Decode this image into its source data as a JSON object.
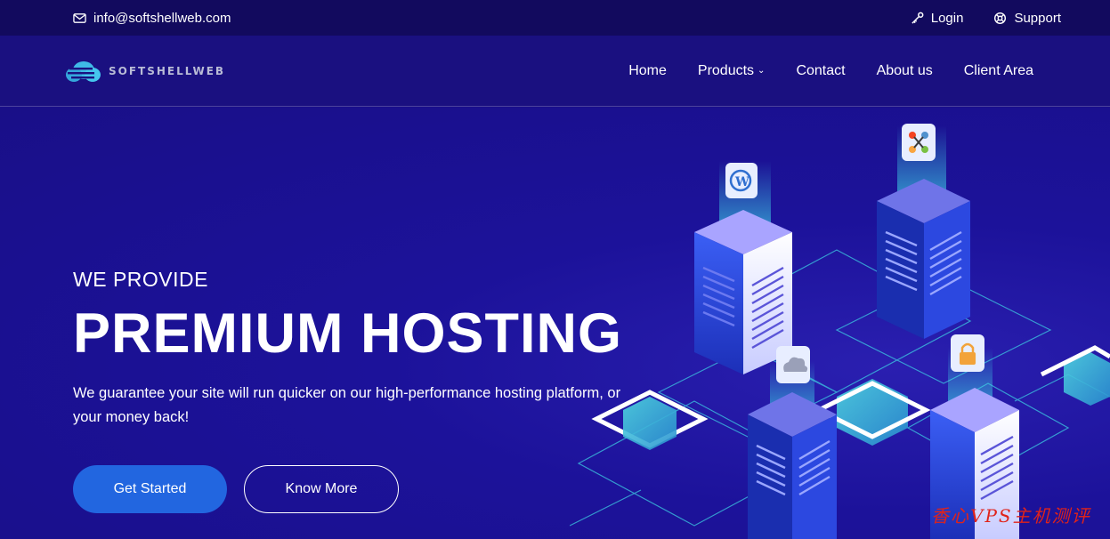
{
  "topbar": {
    "email": "info@softshellweb.com",
    "login_label": "Login",
    "support_label": "Support"
  },
  "brand": {
    "name": "SoftShellWeb"
  },
  "nav": {
    "items": [
      {
        "label": "Home"
      },
      {
        "label": "Products"
      },
      {
        "label": "Contact"
      },
      {
        "label": "About us"
      },
      {
        "label": "Client Area"
      }
    ]
  },
  "hero": {
    "pretitle": "WE PROVIDE",
    "title": "PREMIUM HOSTING",
    "description": "We guarantee your site will run quicker on our high-performance hosting platform, or your money back!",
    "primary_button": "Get Started",
    "secondary_button": "Know More"
  },
  "watermark": "香心VPS主机测评",
  "colors": {
    "topbar_bg": "#120a5e",
    "hero_bg": "#1a0f8a",
    "accent_button": "#2266e0",
    "server_cyan": "#3fd6e6"
  }
}
